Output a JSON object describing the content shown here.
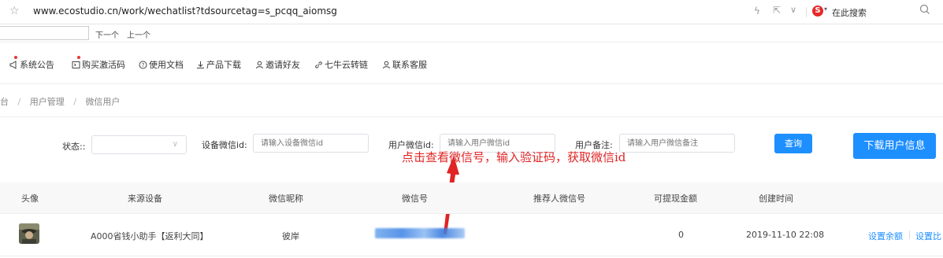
{
  "browser": {
    "url": "www.ecostudio.cn/work/wechatlist?tdsourcetag=s_pcqq_aiomsg",
    "search_placeholder": "在此搜索"
  },
  "findbar": {
    "next_label": "下一个",
    "prev_label": "上一个"
  },
  "topnav": {
    "items": [
      {
        "label": "系统公告",
        "icon": "megaphone-icon"
      },
      {
        "label": "购买激活码",
        "icon": "code-icon"
      },
      {
        "label": "使用文档",
        "icon": "help-circle-icon"
      },
      {
        "label": "产品下载",
        "icon": "download-icon"
      },
      {
        "label": "邀请好友",
        "icon": "user-icon"
      },
      {
        "label": "七牛云转链",
        "icon": "link-icon"
      },
      {
        "label": "联系客服",
        "icon": "user-icon"
      }
    ]
  },
  "breadcrumb": {
    "items": [
      "台",
      "用户管理",
      "微信用户"
    ],
    "separator": "/"
  },
  "filters": {
    "status_label": "状态::",
    "device_label": "设备微信id:",
    "device_placeholder": "请输入设备微信id",
    "user_label": "用户微信id:",
    "user_placeholder": "请输入用户微信id",
    "remark_label": "用户备注:",
    "remark_placeholder": "请输入用户微信备注",
    "query_button": "查询",
    "download_button": "下载用户信息"
  },
  "annotation": {
    "text": "点击查看微信号，输入验证码，获取微信id",
    "color": "#e02424"
  },
  "table": {
    "headers": [
      "头像",
      "来源设备",
      "微信昵称",
      "微信号",
      "推荐人微信号",
      "可提现金额",
      "创建时间"
    ],
    "rows": [
      {
        "source_device": "A000省钱小助手【返利大同】",
        "nickname": "彼岸",
        "wechat_id": "",
        "referrer": "",
        "balance": "0",
        "created": "2019-11-10 22:08",
        "action_1": "设置余额",
        "action_2": "设置比"
      }
    ]
  },
  "colors": {
    "accent": "#1e8fff",
    "annotation": "#e02424"
  }
}
